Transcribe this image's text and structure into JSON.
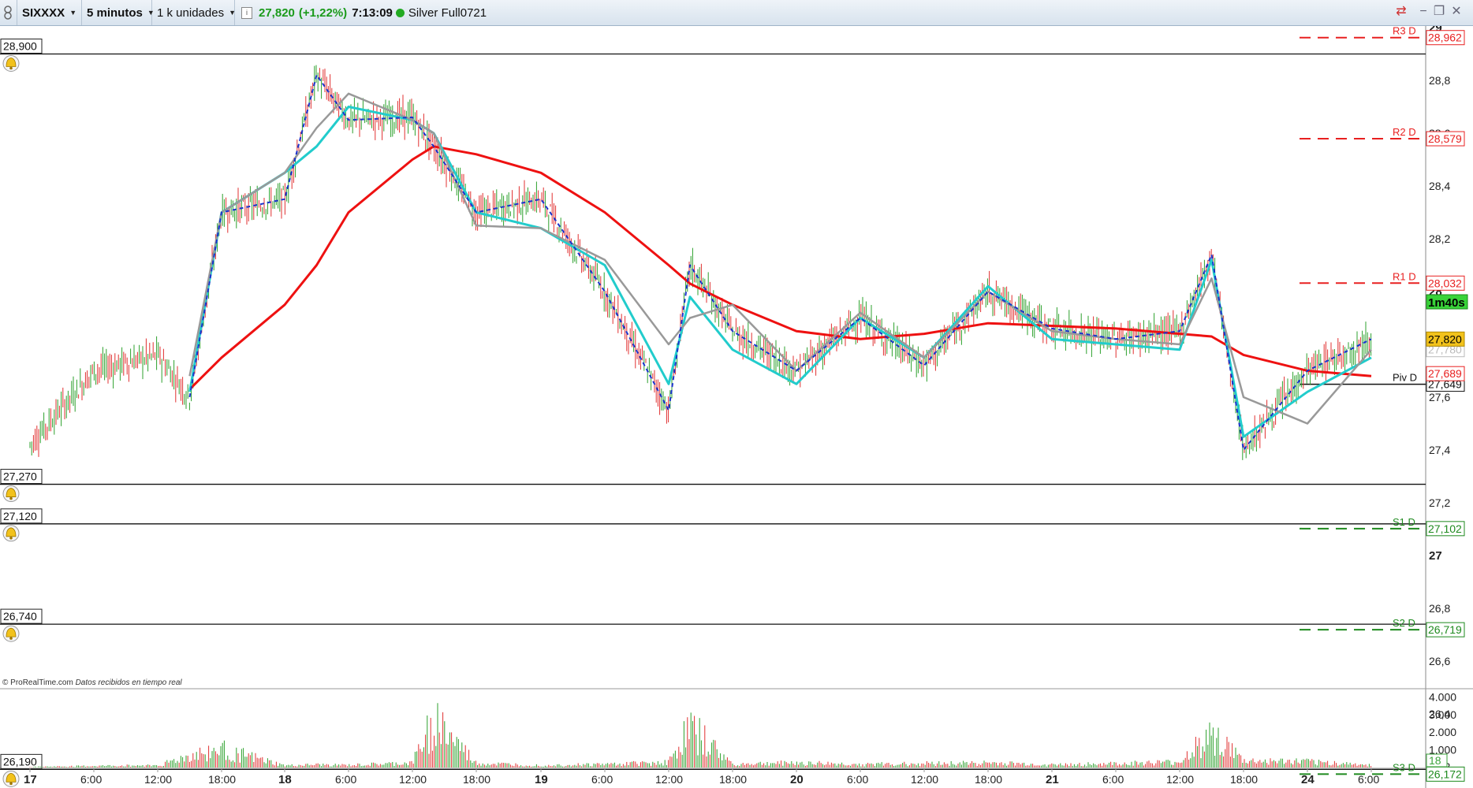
{
  "toolbar": {
    "symbol": "SIXXXX",
    "interval": "5 minutos",
    "units": "1 k unidades",
    "price": "27,820",
    "change": "(+1,22%)",
    "time": "7:13:09",
    "instrument": "Silver Full0721"
  },
  "footer": {
    "source": "© ProRealTime.com",
    "note": "Datos recibidos en tiempo real"
  },
  "alerts": [
    "28,900",
    "27,270",
    "27,120",
    "26,740",
    "26,190"
  ],
  "pivot_labels": {
    "r3": "R3 D",
    "r3_value": "28,962",
    "r2": "R2 D",
    "r2_value": "28,579",
    "r1": "R1 D",
    "r1_value": "28,032",
    "piv": "Piv D",
    "piv_value": "27,649",
    "s1": "S1 D",
    "s1_value": "27,102",
    "s2": "S2 D",
    "s2_value": "26,719",
    "s3": "S3 D",
    "s3_value": "26,172"
  },
  "price_badges": {
    "last": "27,820",
    "countdown": "1m40s",
    "ma_a": "27,780",
    "ma_b": "27,689"
  },
  "y_ticks": [
    "29",
    "28,8",
    "28,6",
    "28,4",
    "28,2",
    "28",
    "27,8",
    "27,6",
    "27,4",
    "27,2",
    "27",
    "26,8",
    "26,6",
    "26,4",
    "26,2"
  ],
  "volume_ticks": [
    "4.000",
    "3.000",
    "2.000",
    "1.000"
  ],
  "volume_badge": "18",
  "x_ticks": [
    "17",
    "6:00",
    "12:00",
    "18:00",
    "18",
    "6:00",
    "12:00",
    "18:00",
    "19",
    "6:00",
    "12:00",
    "18:00",
    "20",
    "6:00",
    "12:00",
    "18:00",
    "21",
    "6:00",
    "12:00",
    "18:00",
    "24",
    "6:00"
  ],
  "colors": {
    "up": "#2ca02c",
    "down": "#e03030",
    "ma_red": "#ee1111",
    "ma_cyan": "#22cccc",
    "ma_gray": "#999999",
    "ma_blue": "#1a33cc",
    "resistance": "#e82020",
    "support": "#1e8a1e"
  },
  "chart_data": {
    "type": "line",
    "title": "",
    "xlabel": "",
    "ylabel": "",
    "ylim": [
      26.1,
      29.05
    ],
    "x": [
      "17 00:00",
      "17 06:00",
      "17 12:00",
      "17 15:00",
      "17 18:00",
      "18 00:00",
      "18 03:00",
      "18 06:00",
      "18 12:00",
      "18 14:00",
      "18 18:00",
      "19 00:00",
      "19 06:00",
      "19 12:00",
      "19 14:00",
      "19 18:00",
      "20 00:00",
      "20 06:00",
      "20 12:00",
      "20 18:00",
      "21 00:00",
      "21 06:00",
      "21 12:00",
      "21 15:00",
      "21 18:00",
      "24 00:00",
      "24 06:00"
    ],
    "series": [
      {
        "values": [
          27.42,
          27.7,
          27.76,
          27.6,
          28.3,
          28.35,
          28.82,
          28.65,
          28.66,
          28.55,
          28.3,
          28.35,
          28.0,
          27.55,
          28.1,
          27.85,
          27.7,
          27.9,
          27.72,
          28.0,
          27.86,
          27.82,
          27.85,
          28.14,
          27.4,
          27.7,
          27.82
        ]
      },
      {
        "values": [
          null,
          null,
          null,
          27.63,
          27.75,
          27.95,
          28.1,
          28.3,
          28.5,
          28.55,
          28.52,
          28.45,
          28.3,
          28.1,
          28.03,
          27.95,
          27.85,
          27.82,
          27.84,
          27.88,
          27.87,
          27.86,
          27.84,
          27.83,
          27.76,
          27.7,
          27.68
        ]
      },
      {
        "values": [
          null,
          null,
          null,
          27.62,
          28.3,
          28.45,
          28.55,
          28.7,
          28.65,
          28.6,
          28.3,
          28.24,
          28.1,
          27.65,
          27.98,
          27.78,
          27.65,
          27.9,
          27.75,
          28.02,
          27.82,
          27.8,
          27.78,
          28.12,
          27.45,
          27.62,
          27.75
        ]
      },
      {
        "values": [
          null,
          null,
          null,
          27.68,
          28.3,
          28.45,
          28.62,
          28.75,
          28.65,
          28.6,
          28.25,
          28.24,
          28.12,
          27.8,
          27.9,
          27.95,
          27.7,
          27.92,
          27.75,
          28.0,
          27.85,
          27.82,
          27.8,
          28.05,
          27.6,
          27.5,
          27.78
        ]
      }
    ],
    "volume": [
      50,
      120,
      180,
      900,
      1400,
      150,
      220,
      180,
      350,
      3800,
      320,
      180,
      260,
      420,
      3100,
      260,
      380,
      240,
      320,
      360,
      220,
      300,
      420,
      2700,
      500,
      450,
      200
    ],
    "volume_ylim": [
      0,
      4200
    ],
    "pivots": {
      "R3 D": 28.962,
      "R2 D": 28.579,
      "R1 D": 28.032,
      "Piv D": 27.649,
      "S1 D": 27.102,
      "S2 D": 26.719,
      "S3 D": 26.172
    },
    "alert_levels": [
      28.9,
      27.27,
      27.12,
      26.74,
      26.19
    ],
    "grid": false
  }
}
